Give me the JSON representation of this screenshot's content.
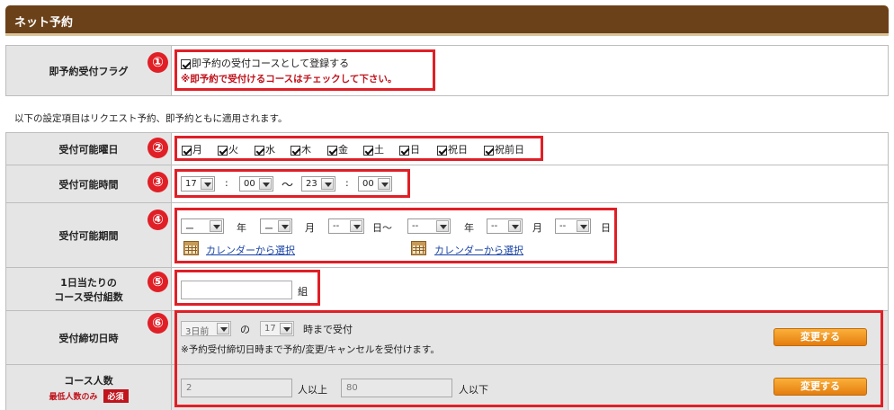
{
  "panel": {
    "title": "ネット予約"
  },
  "instant_flag": {
    "label": "即予約受付フラグ",
    "checkbox_label": "即予約の受付コースとして登録する",
    "checked": true,
    "warning": "※即予約で受付けるコースはチェックして下さい。"
  },
  "note": "以下の設定項目はリクエスト予約、即予約ともに適用されます。",
  "weekdays": {
    "label": "受付可能曜日",
    "days": [
      {
        "name": "月",
        "checked": true
      },
      {
        "name": "火",
        "checked": true
      },
      {
        "name": "水",
        "checked": true
      },
      {
        "name": "木",
        "checked": true
      },
      {
        "name": "金",
        "checked": true
      },
      {
        "name": "土",
        "checked": true
      },
      {
        "name": "日",
        "checked": true
      },
      {
        "name": "祝日",
        "checked": true
      },
      {
        "name": "祝前日",
        "checked": true
      }
    ]
  },
  "hours": {
    "label": "受付可能時間",
    "start_hour": "17",
    "start_min": "00",
    "end_hour": "23",
    "end_min": "00",
    "colon": ":",
    "tilde": "〜"
  },
  "period": {
    "label": "受付可能期間",
    "from_year": "ー",
    "from_month": "ー",
    "from_day": "--",
    "to_year": "--",
    "to_month": "--",
    "to_day": "--",
    "year_unit": "年",
    "month_unit": "月",
    "day_unit": "日",
    "day_tilde_unit": "日〜",
    "calendar_link": "カレンダーから選択"
  },
  "groups_per_day": {
    "label_line1": "1日当たりの",
    "label_line2": "コース受付組数",
    "value": "",
    "unit": "組"
  },
  "deadline": {
    "label": "受付締切日時",
    "day_value": "3日前",
    "connector": "の",
    "hour_value": "17",
    "suffix": "時まで受付",
    "note": "※予約受付締切日時まで予約/変更/キャンセルを受付けます。",
    "button": "変更する"
  },
  "people": {
    "label": "コース人数",
    "sublabel": "最低人数のみ",
    "required": "必須",
    "min_value": "2",
    "min_suffix": "人以上",
    "max_value": "80",
    "max_suffix": "人以下",
    "button": "変更する"
  },
  "markers": [
    "①",
    "②",
    "③",
    "④",
    "⑤",
    "⑥"
  ],
  "colors": {
    "header": "#6b4119",
    "highlight": "#e01f26",
    "button": "#f29a22",
    "warning": "#c0131c",
    "link": "#1a44a8"
  }
}
